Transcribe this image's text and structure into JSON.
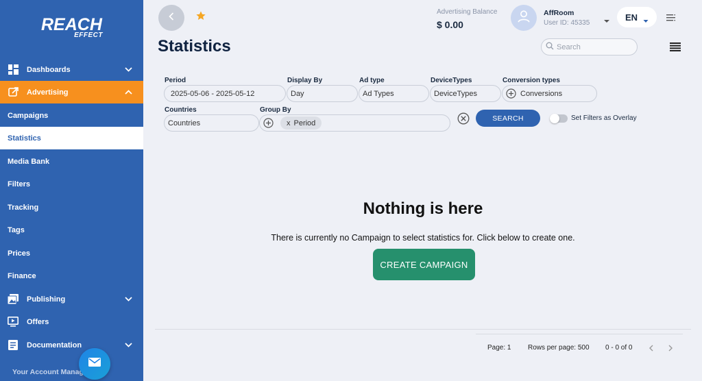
{
  "brand": {
    "logo_main": "REACH",
    "logo_sub": "EFFECT"
  },
  "sidebar": {
    "items": [
      {
        "label": "Dashboards"
      },
      {
        "label": "Advertising"
      },
      {
        "label": "Campaigns"
      },
      {
        "label": "Statistics"
      },
      {
        "label": "Media Bank"
      },
      {
        "label": "Filters"
      },
      {
        "label": "Tracking"
      },
      {
        "label": "Tags"
      },
      {
        "label": "Prices"
      },
      {
        "label": "Finance"
      },
      {
        "label": "Publishing"
      },
      {
        "label": "Offers"
      },
      {
        "label": "Documentation"
      }
    ],
    "account_label": "Your Account Manag"
  },
  "header": {
    "balance_label": "Advertising Balance",
    "balance_value": "$ 0.00",
    "user_name": "AffRoom",
    "user_id": "User ID: 45335",
    "language": "EN"
  },
  "page": {
    "title": "Statistics",
    "search_placeholder": "Search"
  },
  "filters": {
    "period_label": "Period",
    "period_value": "2025-05-06 - 2025-05-12",
    "display_by_label": "Display By",
    "display_by_value": "Day",
    "ad_type_label": "Ad type",
    "ad_type_value": "Ad Types",
    "device_types_label": "DeviceTypes",
    "device_types_value": "DeviceTypes",
    "conversion_types_label": "Conversion types",
    "conversion_types_value": "Conversions",
    "countries_label": "Countries",
    "countries_value": "Countries",
    "group_by_label": "Group By",
    "group_by_chip_x": "x",
    "group_by_chip": "Period",
    "search_button": "SEARCH",
    "overlay_label": "Set Filters as Overlay"
  },
  "empty_state": {
    "title": "Nothing is here",
    "text": "There is currently no Campaign to select statistics for. Click below to create one.",
    "button": "CREATE CAMPAIGN"
  },
  "pagination": {
    "page_label": "Page: 1",
    "rows_label": "Rows per page: 500",
    "range": "0 - 0 of 0"
  },
  "colors": {
    "sidebar": "#2f63b0",
    "accent_orange": "#f7901e",
    "create_green": "#26906d",
    "star": "#f5a623"
  }
}
